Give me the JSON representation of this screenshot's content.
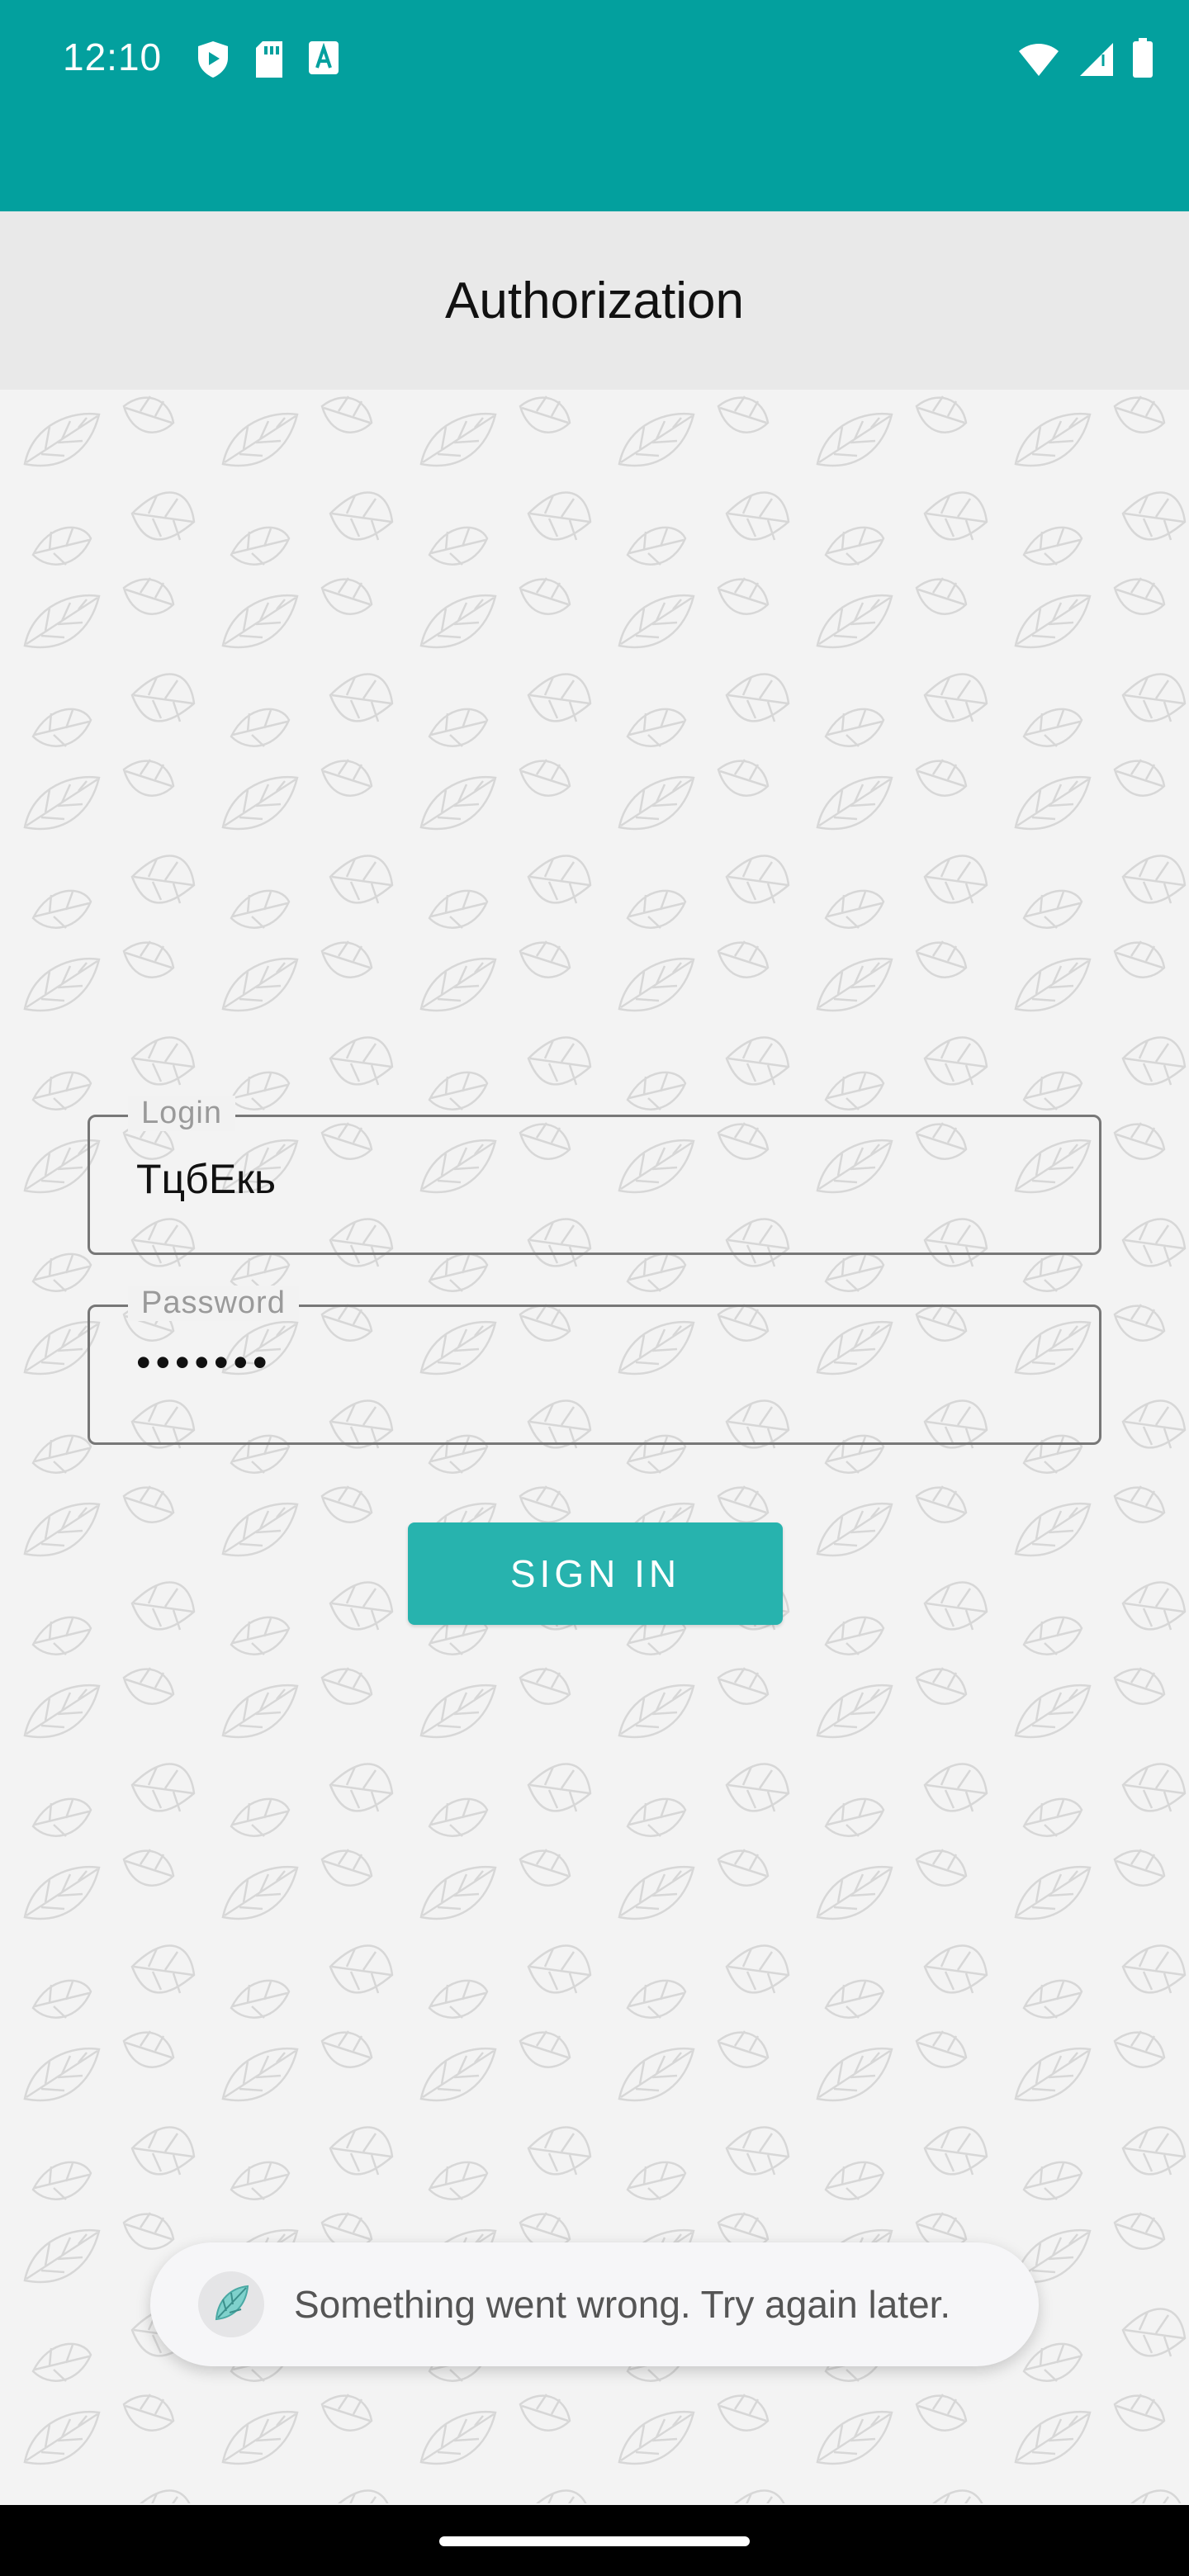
{
  "status_bar": {
    "time": "12:10",
    "icons_left": [
      "shield-play-icon",
      "sd-card-icon",
      "font-icon"
    ],
    "icons_right": [
      "wifi-icon",
      "signal-icon",
      "battery-icon"
    ],
    "color": "#03a09e"
  },
  "toolbar": {
    "title": "Authorization"
  },
  "form": {
    "login": {
      "label": "Login",
      "value": "ТцбЕкь"
    },
    "password": {
      "label": "Password",
      "value": "•••••••"
    },
    "sign_in_label": "SIGN IN"
  },
  "toast": {
    "message": "Something went wrong. Try again later.",
    "icon": "app-leaf-icon"
  },
  "colors": {
    "accent": "#27b3ae",
    "status": "#03a09e"
  }
}
